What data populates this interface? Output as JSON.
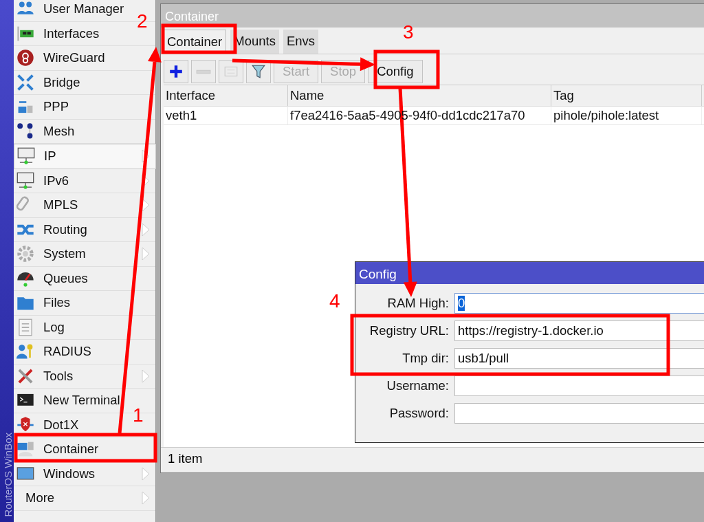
{
  "brand": "RouterOS WinBox",
  "menu": [
    {
      "label": "User Manager",
      "kind": "app",
      "submenu": false,
      "selected": false
    },
    {
      "label": "Interfaces",
      "kind": "app",
      "submenu": false,
      "selected": false
    },
    {
      "label": "WireGuard",
      "kind": "app",
      "submenu": false,
      "selected": false
    },
    {
      "label": "Bridge",
      "kind": "app",
      "submenu": false,
      "selected": false
    },
    {
      "label": "PPP",
      "kind": "app",
      "submenu": false,
      "selected": false
    },
    {
      "label": "Mesh",
      "kind": "app",
      "submenu": false,
      "selected": false
    },
    {
      "label": "IP",
      "kind": "app",
      "submenu": true,
      "selected": true
    },
    {
      "label": "IPv6",
      "kind": "app",
      "submenu": true,
      "selected": false
    },
    {
      "label": "MPLS",
      "kind": "app",
      "submenu": true,
      "selected": false
    },
    {
      "label": "Routing",
      "kind": "app",
      "submenu": true,
      "selected": false
    },
    {
      "label": "System",
      "kind": "app",
      "submenu": true,
      "selected": false
    },
    {
      "label": "Queues",
      "kind": "app",
      "submenu": false,
      "selected": false
    },
    {
      "label": "Files",
      "kind": "app",
      "submenu": false,
      "selected": false
    },
    {
      "label": "Log",
      "kind": "app",
      "submenu": false,
      "selected": false
    },
    {
      "label": "RADIUS",
      "kind": "app",
      "submenu": false,
      "selected": false
    },
    {
      "label": "Tools",
      "kind": "app",
      "submenu": true,
      "selected": false
    },
    {
      "label": "New Terminal",
      "kind": "app",
      "submenu": false,
      "selected": false
    },
    {
      "label": "Dot1X",
      "kind": "app",
      "submenu": false,
      "selected": false
    },
    {
      "label": "Container",
      "kind": "app",
      "submenu": false,
      "selected": false
    },
    {
      "label": "Windows",
      "kind": "app",
      "submenu": true,
      "selected": false
    },
    {
      "label": "More",
      "kind": "plain",
      "submenu": true,
      "selected": false
    }
  ],
  "window": {
    "title": "Container",
    "tabs": [
      {
        "label": "Container",
        "selected": true
      },
      {
        "label": "Mounts",
        "selected": false
      },
      {
        "label": "Envs",
        "selected": false
      }
    ],
    "toolbar": [
      {
        "kind": "add",
        "disabled": false
      },
      {
        "kind": "remove",
        "disabled": true
      },
      {
        "kind": "comment",
        "disabled": true
      },
      {
        "kind": "filter",
        "disabled": false
      },
      {
        "kind": "text",
        "label": "Start",
        "disabled": true
      },
      {
        "kind": "text",
        "label": "Stop",
        "disabled": true
      },
      {
        "kind": "text",
        "label": "Config",
        "disabled": false
      }
    ],
    "table": {
      "columns": [
        "Interface",
        "Name",
        "Tag"
      ],
      "rows": [
        [
          "veth1",
          "f7ea2416-5aa5-4905-94f0-dd1cdc217a70",
          "pihole/pihole:latest"
        ]
      ]
    },
    "status_bar": "1 item"
  },
  "dialog": {
    "title": "Config",
    "fields": [
      {
        "label": "RAM High:",
        "value": "0",
        "highlighted": true
      },
      {
        "label": "Registry URL:",
        "value": "https://registry-1.docker.io",
        "highlighted": false
      },
      {
        "label": "Tmp dir:",
        "value": "usb1/pull",
        "highlighted": false
      },
      {
        "label": "Username:",
        "highlighted": false
      },
      {
        "label": "Password:",
        "highlighted": false
      }
    ]
  },
  "annotations": [
    {
      "number": "1"
    },
    {
      "number": "2"
    },
    {
      "number": "3"
    },
    {
      "number": "4"
    }
  ]
}
